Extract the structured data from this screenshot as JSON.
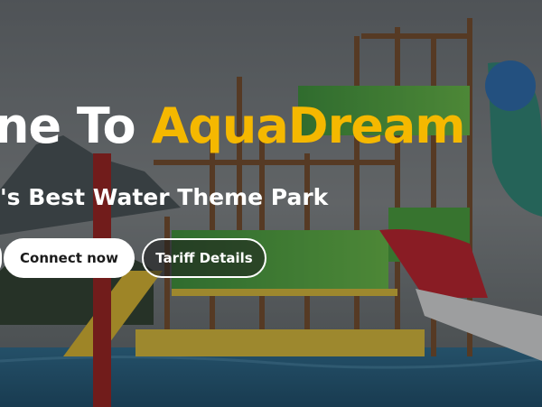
{
  "hero": {
    "title_prefix": "ne To ",
    "title_brand": "AquaDream",
    "subtitle": "'s Best Water Theme Park"
  },
  "buttons": {
    "connect_label": "Connect now",
    "tariff_label": "Tariff Details"
  },
  "colors": {
    "brand_yellow": "#f5b800",
    "button_white": "#ffffff"
  }
}
